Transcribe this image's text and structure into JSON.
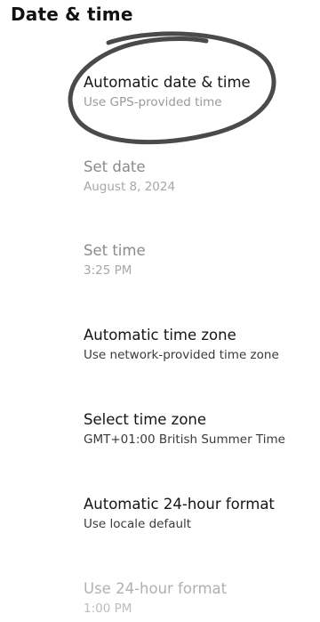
{
  "header": {
    "title": "Date & time"
  },
  "settings": [
    {
      "title": "Automatic date & time",
      "summary": "Use GPS-provided time"
    },
    {
      "title": "Set date",
      "summary": "August 8, 2024"
    },
    {
      "title": "Set time",
      "summary": "3:25 PM"
    },
    {
      "title": "Automatic time zone",
      "summary": "Use network-provided time zone"
    },
    {
      "title": "Select time zone",
      "summary": "GMT+01:00 British Summer Time"
    },
    {
      "title": "Automatic 24-hour format",
      "summary": "Use locale default"
    },
    {
      "title": "Use 24-hour format",
      "summary": "1:00 PM"
    }
  ],
  "colors": {
    "highlight_stroke": "#4a4a4a"
  }
}
